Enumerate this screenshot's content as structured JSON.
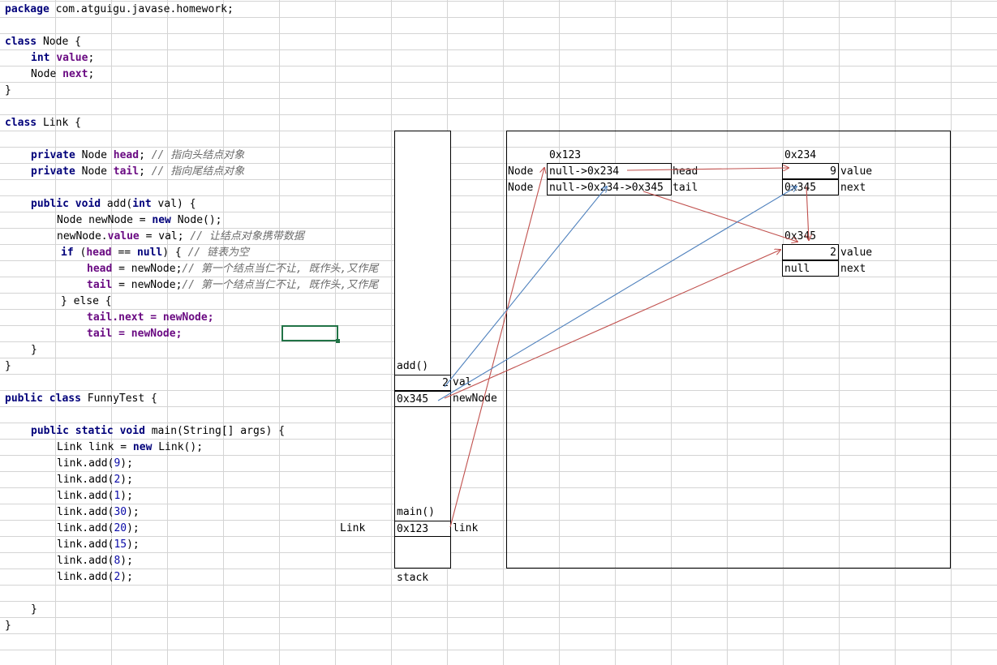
{
  "code": {
    "package_kw": "package",
    "package_name": " com.atguigu.javase.homework;",
    "class_kw": "class",
    "node_class_name": " Node {",
    "int_kw": "int",
    "value_field": "value",
    "semicolon": ";",
    "node_type": "Node ",
    "next_field": "next",
    "close_brace": "}",
    "link_class_name": " Link {",
    "private_kw": "private",
    "node_type_sp": " Node ",
    "head_field": "head",
    "tail_field": "tail",
    "comment_head": " // 指向头结点对象",
    "comment_tail": " // 指向尾结点对象",
    "public_kw": "public",
    "void_kw": "void",
    "add_sig_1": " add(",
    "add_sig_2": " val) {",
    "newnode_line_1": "Node newNode = ",
    "new_kw": "new",
    "newnode_line_2": " Node();",
    "assign_value_1": "newNode.",
    "assign_value_2": " = val; ",
    "comment_value": "// 让结点对象携带数据",
    "if_kw": "if",
    "if_1": " (",
    "if_2": " == ",
    "null_kw": "null",
    "if_3": ") { ",
    "comment_empty": "// 链表为空",
    "assign_head_2": " = newNode;",
    "comment_first": "// 第一个结点当仁不让, 既作头,又作尾",
    "else_line": "} else {",
    "tail_next_line": "tail.next = newNode;",
    "tail_assign_line": "tail = newNode;",
    "class_sp": " class",
    "funny_name": " FunnyTest {",
    "static_kw": "static",
    "main_sig": " main(String[] args) {",
    "link_new_1": "Link link = ",
    "link_new_2": " Link();",
    "add_call": "link.add(",
    "add_close": ");",
    "add_args": [
      "9",
      "2",
      "1",
      "30",
      "20",
      "15",
      "8",
      "2"
    ]
  },
  "stack": {
    "frame_add": "add()",
    "val_value": "2",
    "val_label": "val",
    "newnode_value": "0x345",
    "newnode_label": "newNode",
    "frame_main": "main()",
    "link_type": "Link",
    "link_value": "0x123",
    "link_label": "link",
    "stack_label": "stack"
  },
  "heap": {
    "link_obj": {
      "address": "0x123",
      "head_type": "Node",
      "head_value": "null->0x234",
      "head_label": "head",
      "tail_type": "Node",
      "tail_value": "null->0x234->0x345",
      "tail_label": "tail"
    },
    "node1": {
      "address": "0x234",
      "value": "9",
      "value_label": "value",
      "next": "0x345",
      "next_label": "next"
    },
    "node2": {
      "address": "0x345",
      "value": "2",
      "value_label": "value",
      "next": "null",
      "next_label": "next"
    }
  },
  "colors": {
    "red_arrow": "#c0504d",
    "blue_arrow": "#4f81bd",
    "selection": "#217346"
  }
}
